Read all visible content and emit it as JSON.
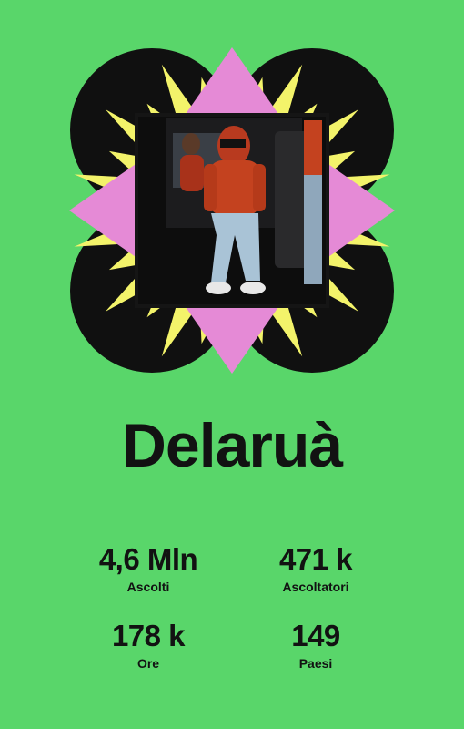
{
  "artist": {
    "name": "Delaruà"
  },
  "stats": [
    {
      "value": "4,6 Mln",
      "label": "Ascolti"
    },
    {
      "value": "471 k",
      "label": "Ascoltatori"
    },
    {
      "value": "178 k",
      "label": "Ore"
    },
    {
      "value": "149",
      "label": "Paesi"
    }
  ],
  "colors": {
    "background": "#59d66a",
    "text": "#121212",
    "burst_yellow": "#f3f36a",
    "burst_pink": "#e58ad6",
    "circle_black": "#101010"
  },
  "artwork": {
    "icon": "album-cover-photo"
  }
}
